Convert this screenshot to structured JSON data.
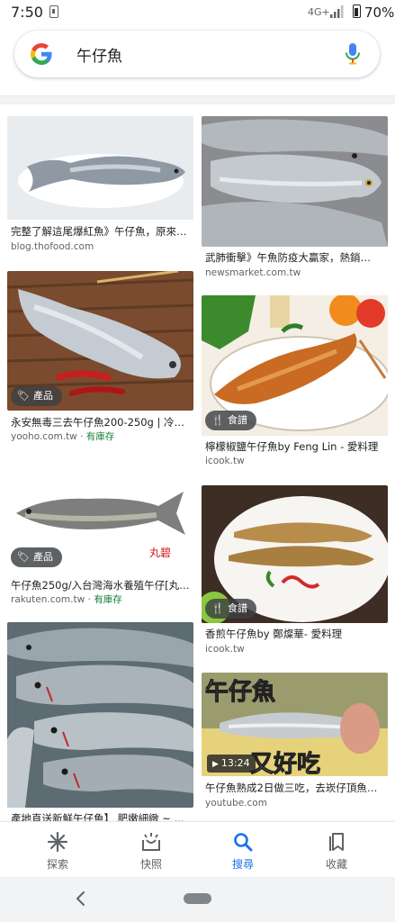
{
  "status_bar": {
    "time": "7:50",
    "network": "4G+",
    "battery": "70%"
  },
  "search": {
    "query": "午仔魚"
  },
  "results": [
    {
      "title": "完整了解這尾爆紅魚》午仔魚，原來…",
      "source": "blog.thofood.com",
      "badge": "",
      "duration": "",
      "stock": ""
    },
    {
      "title": "武肺衝擊》午魚防疫大贏家，熱銷…",
      "source": "newsmarket.com.tw",
      "badge": "",
      "duration": "",
      "stock": ""
    },
    {
      "title": "永安無毒三去午仔魚200-250g | 冷…",
      "source": "yooho.com.tw",
      "badge": "產品",
      "duration": "",
      "stock": "有庫存"
    },
    {
      "title": "檸檬椒鹽午仔魚by Feng Lin - 愛料理",
      "source": "icook.tw",
      "badge": "食譜",
      "duration": "",
      "stock": ""
    },
    {
      "title": "午仔魚250g/入台灣海水養殖午仔[丸…",
      "source": "rakuten.com.tw",
      "badge": "產品",
      "duration": "",
      "stock": "有庫存"
    },
    {
      "title": "香煎午仔魚by 鄭燦華- 愛料理",
      "source": "icook.tw",
      "badge": "食譜",
      "duration": "",
      "stock": ""
    },
    {
      "title": "產地直送新鮮午仔魚】 肥嫩細緻 ~ 入…",
      "source": "",
      "badge": "",
      "duration": "",
      "stock": ""
    },
    {
      "title": "午仔魚熟成2日做三吃，去崁仔頂魚…",
      "source": "youtube.com",
      "badge": "",
      "duration": "13:24",
      "stock": ""
    }
  ],
  "image_text": {
    "rakuten_logo": "丸碧",
    "video_overlay_top": "午仔魚",
    "video_overlay_bottom": "又好吃"
  },
  "bottom_nav": {
    "items": [
      {
        "label": "探索",
        "icon": "asterisk-icon"
      },
      {
        "label": "快照",
        "icon": "snapshot-icon"
      },
      {
        "label": "搜尋",
        "icon": "search-icon",
        "active": true
      },
      {
        "label": "收藏",
        "icon": "collections-icon"
      }
    ]
  },
  "colors": {
    "accent": "#1a73e8",
    "in_stock": "#188038"
  }
}
